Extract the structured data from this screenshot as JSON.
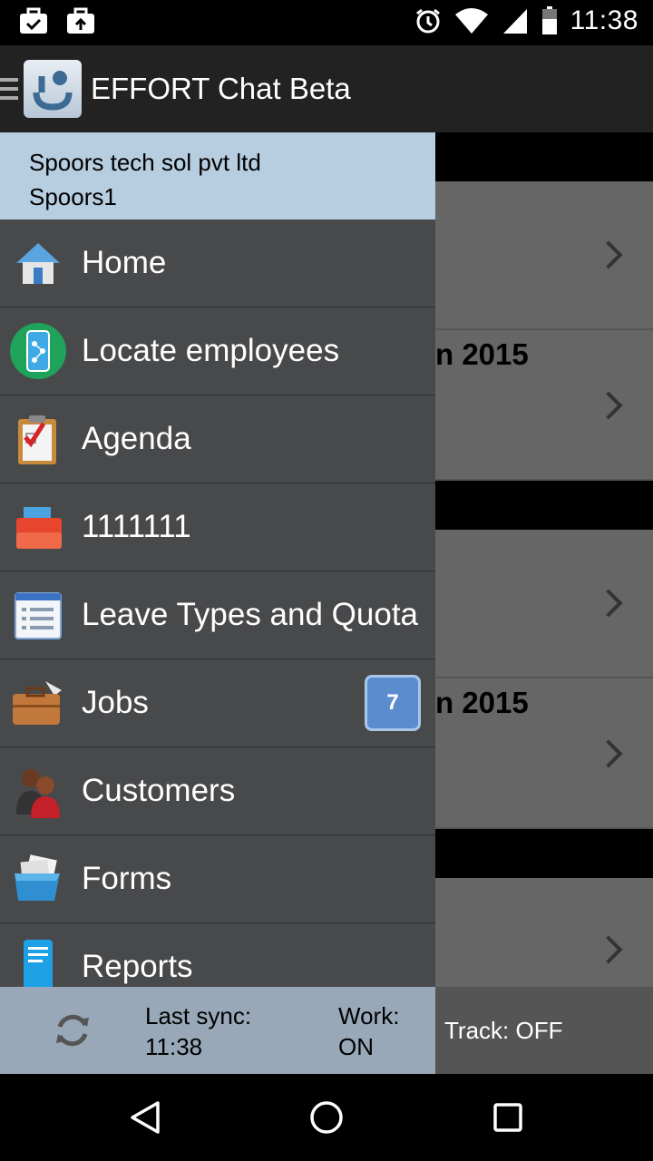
{
  "status_bar": {
    "time": "11:38",
    "icons": [
      "briefcase-check-icon",
      "briefcase-upload-icon",
      "alarm-icon",
      "wifi-icon",
      "signal-icon",
      "battery-icon"
    ]
  },
  "action_bar": {
    "title": "EFFORT Chat Beta"
  },
  "drawer": {
    "company": "Spoors tech sol pvt ltd",
    "user": "Spoors1",
    "items": [
      {
        "label": "Home",
        "icon": "home-icon"
      },
      {
        "label": "Locate employees",
        "icon": "locate-employees-icon"
      },
      {
        "label": "Agenda",
        "icon": "agenda-clipboard-icon"
      },
      {
        "label": "1111111",
        "icon": "folder-icon"
      },
      {
        "label": "Leave Types and Quota",
        "icon": "list-icon"
      },
      {
        "label": "Jobs",
        "icon": "briefcase-icon",
        "badge": "7"
      },
      {
        "label": "Customers",
        "icon": "customers-icon"
      },
      {
        "label": "Forms",
        "icon": "forms-folder-icon"
      },
      {
        "label": "Reports",
        "icon": "reports-phone-icon"
      }
    ],
    "footer": {
      "last_sync_label": "Last sync:",
      "last_sync_time": "11:38",
      "work_label": "Work:",
      "work_value": "ON"
    }
  },
  "background": {
    "partial_1": "n 2015",
    "partial_2": "n 2015",
    "track": "Track: OFF"
  },
  "colors": {
    "drawer_bg": "#48494b",
    "header_bg": "#b7cde0",
    "footer_bg": "#98a8b8",
    "badge_bg": "#5b8dce"
  }
}
